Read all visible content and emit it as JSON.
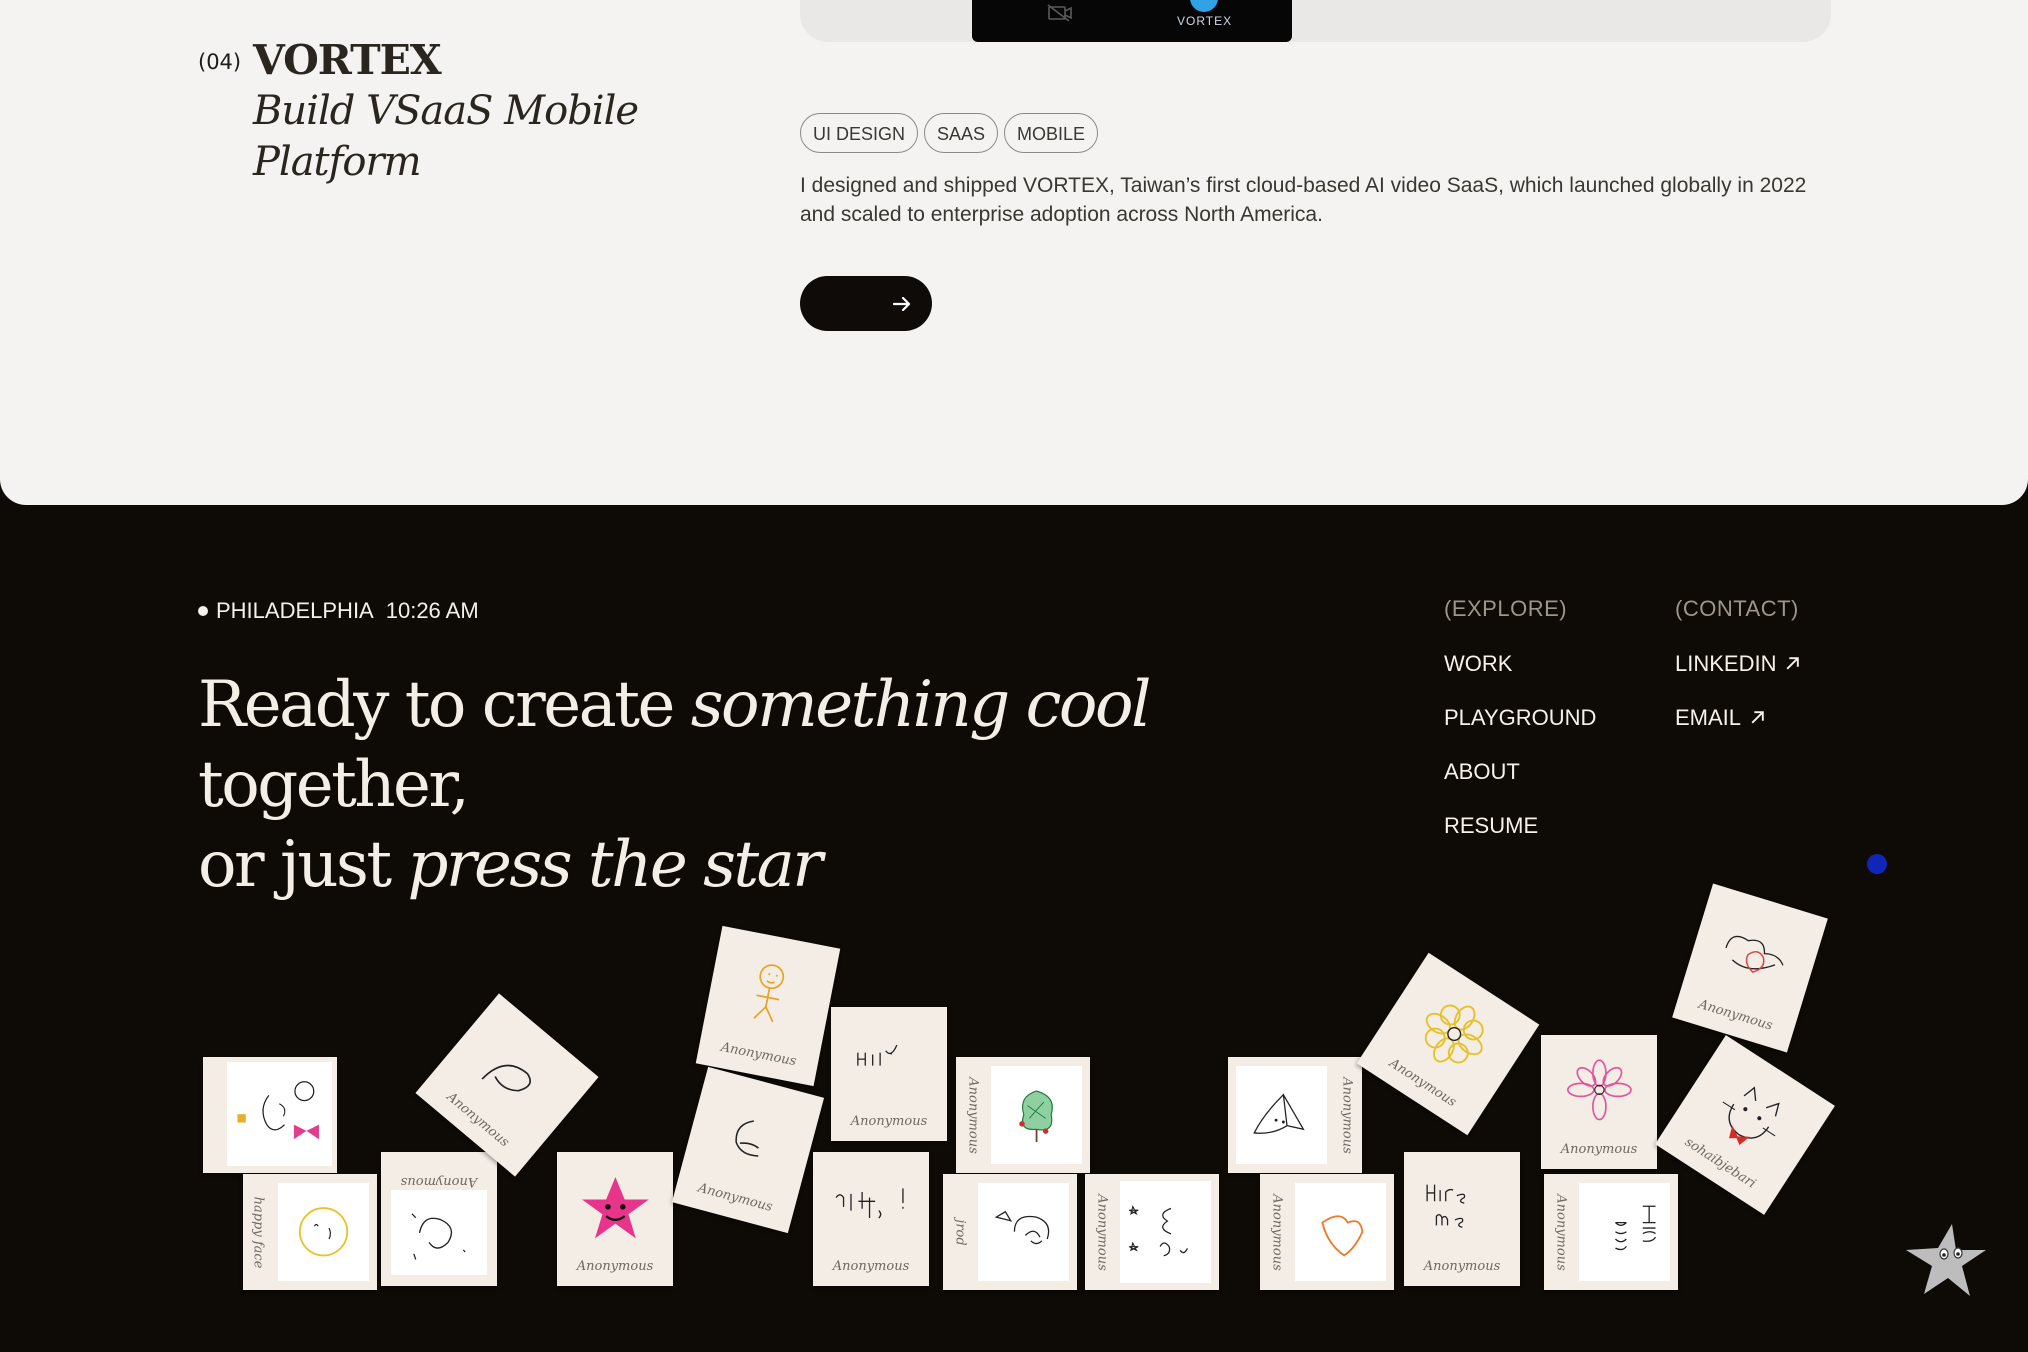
{
  "project": {
    "number": "(04)",
    "title": "VORTEX",
    "subtitle": "Build VSaaS Mobile Platform",
    "device_brand": "VORTEX",
    "tags": [
      "UI DESIGN",
      "SAAS",
      "MOBILE"
    ],
    "description": "I designed and shipped VORTEX, Taiwan’s first cloud-based AI video SaaS, which launched globally in 2022 and scaled to enterprise adoption across North America.",
    "cta_icon": "arrow-right-icon"
  },
  "footer": {
    "location": "PHILADELPHIA",
    "time": "10:26 AM",
    "headline": {
      "part1": "Ready to create ",
      "part2_italic": "something cool",
      "part3": " together,",
      "part4": "or just ",
      "part5_italic": "press the star"
    },
    "explore": {
      "heading": "(EXPLORE)",
      "links": [
        "WORK",
        "PLAYGROUND",
        "ABOUT",
        "RESUME"
      ]
    },
    "contact": {
      "heading": "(CONTACT)",
      "links": [
        "LINKEDIN",
        "EMAIL"
      ]
    },
    "accent_color": "#1026b8",
    "star_icon": "star-face-icon"
  },
  "doodles": [
    {
      "sig": "",
      "art": "girl-with-bow"
    },
    {
      "sig": "happy face",
      "art": "smiley-outline"
    },
    {
      "sig": "Anonymous",
      "art": "scribble-face"
    },
    {
      "sig": "Anonymous",
      "art": "leaf-loop"
    },
    {
      "sig": "Anonymous",
      "art": "pink-star"
    },
    {
      "sig": "Anonymous",
      "art": "yellow-stick-figure"
    },
    {
      "sig": "Anonymous",
      "art": "squiggle"
    },
    {
      "sig": "Anonymous",
      "art": "hi-text"
    },
    {
      "sig": "Anonymous",
      "art": "hanzi-text"
    },
    {
      "sig": "Anonymous",
      "art": "green-tree"
    },
    {
      "sig": "jrod",
      "art": "bird-sketch"
    },
    {
      "sig": "Anonymous",
      "art": "stars-letters"
    },
    {
      "sig": "Anonymous",
      "art": "fish-face"
    },
    {
      "sig": "Anonymous",
      "art": "orange-heart"
    },
    {
      "sig": "Anonymous",
      "art": "yellow-flower"
    },
    {
      "sig": "Anonymous",
      "art": "hire-me-text"
    },
    {
      "sig": "Anonymous",
      "art": "pink-flower"
    },
    {
      "sig": "Anonymous",
      "art": "hire-me-vertical"
    },
    {
      "sig": "Anonymous",
      "art": "heart-scribble"
    },
    {
      "sig": "sohaibjebari",
      "art": "red-cat"
    }
  ]
}
